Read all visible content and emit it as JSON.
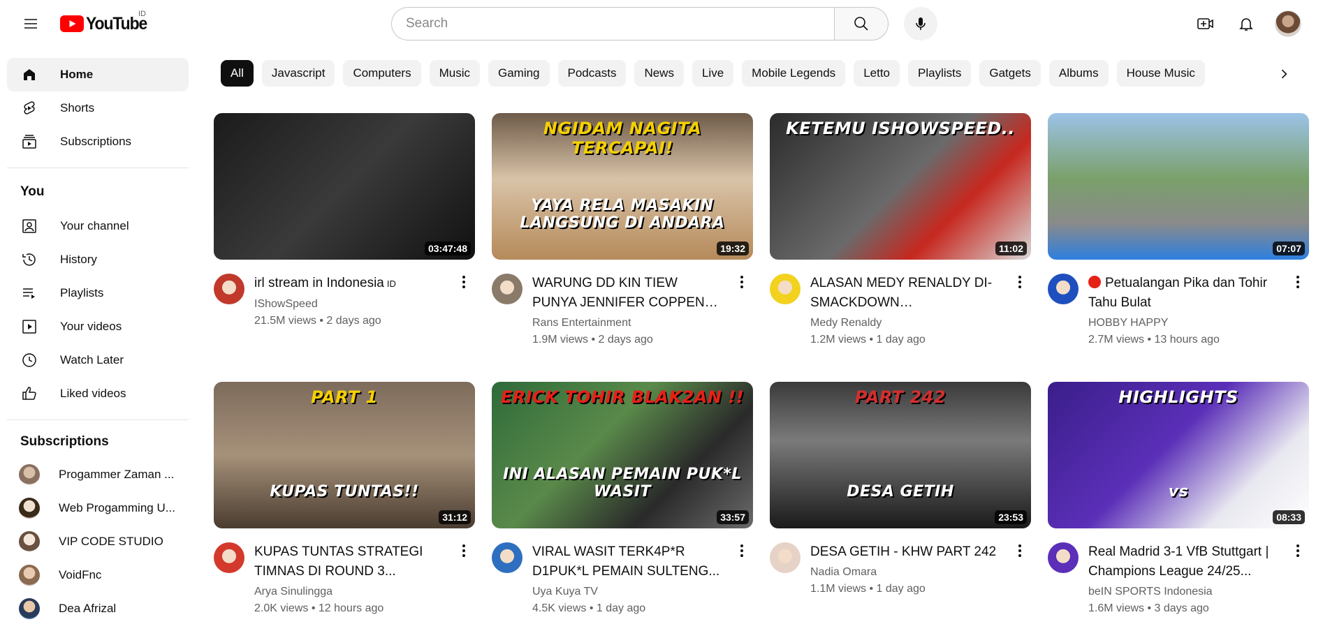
{
  "header": {
    "logo_text": "YouTube",
    "country": "ID",
    "search_placeholder": "Search"
  },
  "sidebar": {
    "main": [
      {
        "label": "Home",
        "icon": "home-icon",
        "active": true
      },
      {
        "label": "Shorts",
        "icon": "shorts-icon"
      },
      {
        "label": "Subscriptions",
        "icon": "subscriptions-icon"
      }
    ],
    "you_heading": "You",
    "you": [
      {
        "label": "Your channel",
        "icon": "your-channel-icon"
      },
      {
        "label": "History",
        "icon": "history-icon"
      },
      {
        "label": "Playlists",
        "icon": "playlists-icon"
      },
      {
        "label": "Your videos",
        "icon": "your-videos-icon"
      },
      {
        "label": "Watch Later",
        "icon": "watch-later-icon"
      },
      {
        "label": "Liked videos",
        "icon": "liked-videos-icon"
      }
    ],
    "subs_heading": "Subscriptions",
    "subscriptions": [
      {
        "label": "Progammer Zaman ...",
        "color": "#b9a89a"
      },
      {
        "label": "Web Progamming U...",
        "color": "#6b5a4a"
      },
      {
        "label": "VIP CODE STUDIO",
        "color": "#c8b8a8"
      },
      {
        "label": "VoidFnc",
        "color": "#a0826d"
      },
      {
        "label": "Dea Afrizal",
        "color": "#3a5f8a"
      }
    ]
  },
  "chips": [
    "All",
    "Javascript",
    "Computers",
    "Music",
    "Gaming",
    "Podcasts",
    "News",
    "Live",
    "Mobile Legends",
    "Letto",
    "Playlists",
    "Gatgets",
    "Albums",
    "House Music"
  ],
  "videos": [
    {
      "title": "irl stream in Indonesia",
      "badge": "ID",
      "channel": "IShowSpeed",
      "views": "21.5M views",
      "age": "2 days ago",
      "duration": "03:47:48",
      "caption": "",
      "bg": "linear-gradient(135deg,#1b1b1b,#3a3a3a 50%,#111)",
      "avatar": "#c0392b",
      "accent": "#d21f2a"
    },
    {
      "title": "WARUNG DD KIN TIEW PUNYA JENNIFER COPPEN PINDAH...",
      "channel": "Rans Entertainment",
      "views": "1.9M views",
      "age": "2 days ago",
      "duration": "19:32",
      "caption": "NGIDAM NAGITA TERCAPAI!",
      "caption2": "YAYA RELA MASAKIN LANGSUNG DI ANDARA",
      "bg": "linear-gradient(180deg,#6d5a48,#d9c3a8 45%,#b58a5a)",
      "avatar": "#8a7a6a",
      "accent": "#f5d000"
    },
    {
      "title": "ALASAN MEDY RENALDY DI-SMACKDOWN ISHOWSPEED..",
      "channel": "Medy Renaldy",
      "views": "1.2M views",
      "age": "1 day ago",
      "duration": "11:02",
      "caption": "KETEMU ISHOWSPEED..",
      "bg": "linear-gradient(135deg,#2b2b2b,#6a6a6a 50%,#c6281f 70%,#d8d8d8)",
      "avatar": "#f2d21e",
      "accent": "#ffffff"
    },
    {
      "title": "Petualangan Pika dan Tohir Tahu Bulat",
      "live": true,
      "channel": "HOBBY HAPPY",
      "views": "2.7M views",
      "age": "13 hours ago",
      "duration": "07:07",
      "caption": "",
      "bg": "linear-gradient(180deg,#9cc3e8,#7aa06a 45%,#8a8a8a 75%,#2d7fe0)",
      "avatar": "#1f4fbf",
      "accent": "#e05aa0"
    },
    {
      "title": "KUPAS TUNTAS STRATEGI TIMNAS DI ROUND 3...",
      "channel": "Arya Sinulingga",
      "views": "2.0K views",
      "age": "12 hours ago",
      "duration": "31:12",
      "caption": "PART 1",
      "caption2": "KUPAS TUNTAS!!",
      "bg": "linear-gradient(180deg,#7d6b5b,#a6917a 50%,#4a3c30)",
      "avatar": "#d33a2c",
      "accent": "#f5d000"
    },
    {
      "title": "VIRAL WASIT TERK4P*R D1PUK*L PEMAIN SULTENG...",
      "channel": "Uya Kuya TV",
      "views": "4.5K views",
      "age": "1 day ago",
      "duration": "33:57",
      "caption": "ERICK TOHIR BLAK2AN !!",
      "caption2": "INI ALASAN PEMAIN PUK*L WASIT",
      "bg": "linear-gradient(135deg,#2f6a3a,#5a8a4a 40%,#2a2a2a 70%,#6a6a6a)",
      "avatar": "#2f6fbf",
      "accent": "#e62117"
    },
    {
      "title": "DESA GETIH - KHW PART 242",
      "channel": "Nadia Omara",
      "views": "1.1M views",
      "age": "1 day ago",
      "duration": "23:53",
      "caption": "PART 242",
      "caption2": "DESA GETIH",
      "bg": "linear-gradient(180deg,#3a3a3a,#7a7a7a 40%,#1a1a1a)",
      "avatar": "#e6d2c6",
      "accent": "#d32f2f"
    },
    {
      "title": "Real Madrid 3-1 VfB Stuttgart | Champions League 24/25...",
      "channel": "beIN SPORTS Indonesia",
      "views": "1.6M views",
      "age": "3 days ago",
      "duration": "08:33",
      "caption": "HIGHLIGHTS",
      "caption2": "vs",
      "bg": "linear-gradient(135deg,#3a1e8a,#5b2fb8 45%,#e8e8f0 75%,#ffffff)",
      "avatar": "#5b2fb8",
      "accent": "#ffffff"
    }
  ]
}
